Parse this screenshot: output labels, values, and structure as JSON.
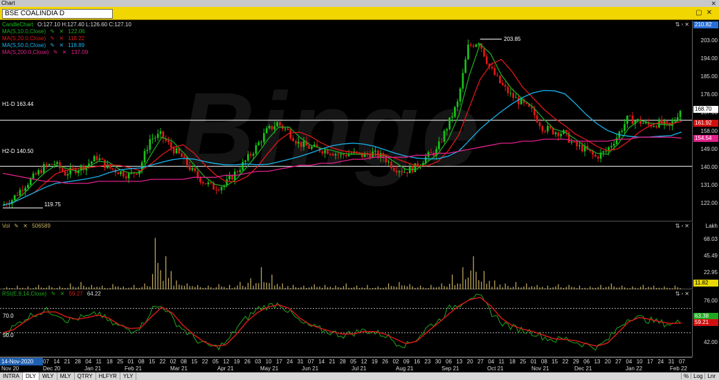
{
  "window": {
    "title": "Chart"
  },
  "symbol_bar": {
    "symbol": "BSE COALINDIA D"
  },
  "price_pane": {
    "legend": {
      "candle": {
        "label": "CandleChart",
        "ohlc": "O:127.10  H:127.40  L:126.60  C:127.10"
      },
      "ma10": {
        "label": "MA(S,10.0,Close)",
        "value": "122.06"
      },
      "ma20": {
        "label": "MA(S,20.0,Close)",
        "value": "118.22"
      },
      "ma50": {
        "label": "MA(S,50.0,Close)",
        "value": "118.89"
      },
      "ma200": {
        "label": "MA(S,200.0,Close)",
        "value": "137.09"
      }
    },
    "hlines": [
      {
        "label": "H1-D 163.44",
        "value": 163.44
      },
      {
        "label": "H2-D 140.50",
        "value": 140.5
      }
    ],
    "annotations": {
      "high": "203.85",
      "low": "119.75"
    },
    "watermark": "Binge",
    "axis_ticks": [
      "203.00",
      "194.00",
      "185.00",
      "176.00",
      "167.00",
      "158.00",
      "149.00",
      "140.00",
      "131.00",
      "122.00"
    ],
    "tags": [
      {
        "text": "210.82",
        "color": "#2a6fd6",
        "value": 210.82
      },
      {
        "text": "168.70",
        "color": "#ffffff",
        "value": 168.7
      },
      {
        "text": "161.92",
        "color": "#d01010",
        "value": 161.92
      },
      {
        "text": "154.54",
        "color": "#e0208a",
        "value": 154.54
      }
    ]
  },
  "vol_pane": {
    "label": "Vol",
    "value": "506589",
    "unit": "Lakh",
    "axis_ticks": [
      "68.03",
      "45.49",
      "22.95"
    ],
    "tag": "11.82"
  },
  "rsi_pane": {
    "label": "RSI(E,9,14,Close)",
    "value1": "59.27",
    "value2": "64.22",
    "levels": [
      "70.0",
      "50.0"
    ],
    "axis_ticks": [
      "76.00",
      "42.00"
    ],
    "tags": [
      "63.38",
      "59.21"
    ]
  },
  "date_axis": {
    "highlight": "14-Nov-2020",
    "days": [
      "07",
      "14",
      "21",
      "28",
      "04",
      "11",
      "18",
      "25",
      "01",
      "08",
      "15",
      "22",
      "02",
      "08",
      "15",
      "22",
      "05",
      "12",
      "19",
      "26",
      "03",
      "10",
      "17",
      "24",
      "31",
      "07",
      "14",
      "21",
      "28",
      "05",
      "12",
      "19",
      "26",
      "02",
      "09",
      "16",
      "23",
      "30",
      "06",
      "13",
      "20",
      "27",
      "04",
      "11",
      "18",
      "25",
      "01",
      "08",
      "15",
      "22",
      "29",
      "06",
      "13",
      "20",
      "27",
      "04",
      "10",
      "17",
      "24",
      "31",
      "07"
    ],
    "months": [
      "Nov 20",
      "Dec 20",
      "Jan 21",
      "Feb 21",
      "Mar 21",
      "Apr 21",
      "May 21",
      "Jun 21",
      "Jul 21",
      "Aug 21",
      "Sep 21",
      "Oct 21",
      "Nov 21",
      "Dec 21",
      "Jan 22",
      "Feb 22"
    ]
  },
  "bottom_bar": {
    "timeframes": [
      "INTRA",
      "DLY",
      "WLY",
      "MLY",
      "QTRY",
      "HLFYR",
      "YLY"
    ],
    "active": "DLY",
    "scales": [
      "%",
      "Log",
      "Lnr"
    ]
  },
  "colors": {
    "up": "#19c219",
    "down": "#e01818",
    "ma10": "#1fa81f",
    "ma20": "#e01818",
    "ma50": "#19b4ee",
    "ma200": "#e0208a",
    "vol": "#c8b060",
    "rsi": "#1fa81f",
    "rsi_signal": "#e01818"
  },
  "chart_data": {
    "type": "line",
    "title": "BSE COALINDIA D",
    "ylim": [
      113,
      213
    ],
    "price_series": {
      "name": "Close",
      "x_weeks": [
        0,
        1,
        2,
        3,
        4,
        5,
        6,
        7,
        8,
        9,
        10,
        11,
        12,
        13,
        14,
        15,
        16,
        17,
        18,
        19,
        20,
        21,
        22,
        23,
        24,
        25,
        26,
        27,
        28,
        29,
        30,
        31,
        32,
        33,
        34,
        35,
        36,
        37,
        38,
        39,
        40,
        41,
        42,
        43,
        44,
        45,
        46,
        47,
        48,
        49,
        50,
        51,
        52,
        53,
        54,
        55,
        56,
        57,
        58,
        59,
        60,
        61,
        62,
        63,
        64
      ],
      "values": [
        121,
        124,
        130,
        135,
        140,
        142,
        137,
        139,
        141,
        145,
        140,
        138,
        136,
        139,
        154,
        156,
        150,
        145,
        138,
        133,
        130,
        131,
        137,
        143,
        150,
        158,
        162,
        158,
        152,
        150,
        149,
        148,
        146,
        147,
        146,
        147,
        145,
        140,
        138,
        140,
        145,
        148,
        160,
        172,
        200,
        203,
        190,
        182,
        176,
        172,
        168,
        160,
        158,
        157,
        151,
        149,
        145,
        148,
        155,
        164,
        163,
        161,
        162,
        160,
        168.7
      ]
    },
    "ma200_values": [
      137,
      136,
      135,
      134,
      133,
      133,
      132,
      132,
      132,
      133,
      133,
      133,
      133,
      133,
      134,
      134,
      134,
      134,
      135,
      135,
      135,
      136,
      136,
      137,
      138,
      138,
      139,
      140,
      141,
      141,
      142,
      142,
      143,
      144,
      144,
      145,
      145,
      145,
      145,
      146,
      146,
      147,
      147,
      148,
      149,
      150,
      151,
      152,
      152,
      153,
      153,
      154,
      154,
      154,
      153,
      153,
      153,
      153,
      154,
      154,
      155,
      155,
      155,
      155,
      154.5
    ],
    "volume_lakh": [
      3,
      5,
      4,
      6,
      5,
      4,
      8,
      10,
      6,
      5,
      7,
      4,
      6,
      8,
      70,
      45,
      12,
      8,
      6,
      5,
      7,
      6,
      10,
      15,
      30,
      20,
      8,
      6,
      5,
      7,
      6,
      5,
      8,
      5,
      6,
      4,
      8,
      10,
      7,
      5,
      6,
      8,
      20,
      30,
      45,
      25,
      12,
      8,
      10,
      8,
      6,
      5,
      7,
      6,
      5,
      4,
      6,
      8,
      5,
      4,
      6,
      5,
      4,
      5,
      11.82
    ],
    "rsi_values": [
      50,
      55,
      62,
      66,
      68,
      66,
      60,
      62,
      63,
      66,
      58,
      55,
      52,
      56,
      70,
      72,
      60,
      52,
      45,
      40,
      38,
      42,
      55,
      63,
      70,
      72,
      74,
      66,
      58,
      55,
      52,
      50,
      48,
      50,
      52,
      50,
      48,
      42,
      40,
      46,
      55,
      60,
      70,
      74,
      80,
      78,
      66,
      58,
      54,
      52,
      50,
      46,
      44,
      45,
      42,
      40,
      38,
      45,
      55,
      63,
      62,
      60,
      58,
      57,
      59.27
    ]
  }
}
